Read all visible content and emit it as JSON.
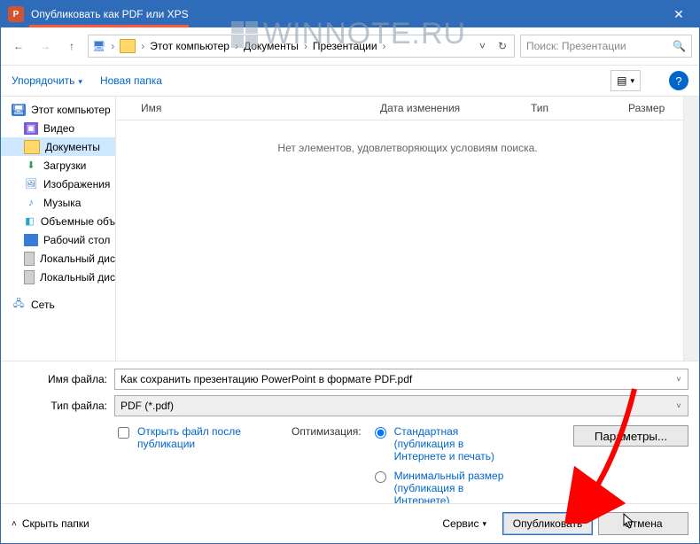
{
  "titlebar": {
    "title": "Опубликовать как PDF или XPS"
  },
  "watermark": "WINNOTE.RU",
  "breadcrumb": [
    "Этот компьютер",
    "Документы",
    "Презентации"
  ],
  "search": {
    "placeholder": "Поиск: Презентации"
  },
  "toolbar": {
    "organize": "Упорядочить",
    "new_folder": "Новая папка"
  },
  "tree": {
    "this_pc": "Этот компьютер",
    "videos": "Видео",
    "documents": "Документы",
    "downloads": "Загрузки",
    "pictures": "Изображения",
    "music": "Музыка",
    "objects3d": "Объемные объ",
    "desktop": "Рабочий стол",
    "disk1": "Локальный дис",
    "disk2": "Локальный дис",
    "network": "Сеть"
  },
  "columns": {
    "name": "Имя",
    "date": "Дата изменения",
    "type": "Тип",
    "size": "Размер"
  },
  "list": {
    "empty": "Нет элементов, удовлетворяющих условиям поиска."
  },
  "bottom": {
    "filename_label": "Имя файла:",
    "filename_value": "Как сохранить презентацию PowerPoint в формате PDF.pdf",
    "filetype_label": "Тип файла:",
    "filetype_value": "PDF (*.pdf)",
    "open_after": "Открыть файл после публикации",
    "optimization_label": "Оптимизация:",
    "opt_standard": "Стандартная (публикация в Интернете и печать)",
    "opt_minimum": "Минимальный размер (публикация в Интернете)",
    "options_btn": "Параметры..."
  },
  "footer": {
    "hide_folders": "Скрыть папки",
    "tools": "Сервис",
    "publish": "Опубликовать",
    "cancel": "Отмена"
  }
}
